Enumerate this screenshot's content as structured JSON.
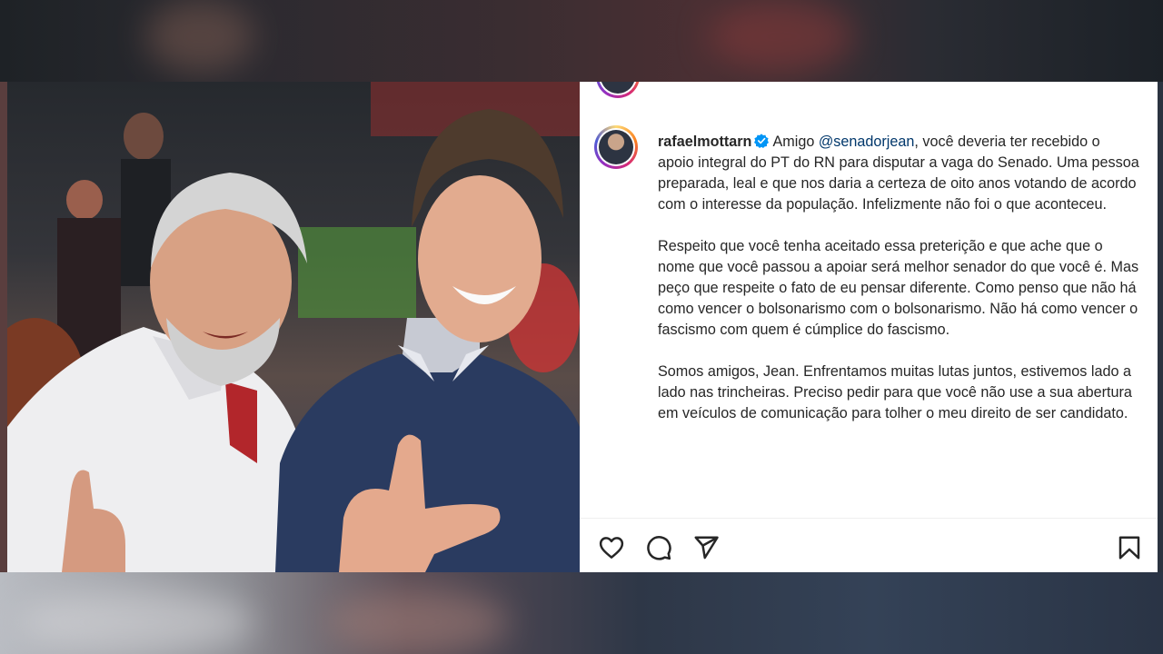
{
  "post": {
    "username": "rafaelmottarn",
    "caption_lead": "Amigo ",
    "mention": "@senadorjean",
    "paragraph1_rest": ", você deveria ter recebido o apoio integral do PT do RN para disputar a vaga do Senado. Uma pessoa preparada, leal e que nos daria a certeza de oito anos votando de acordo com o interesse da população. Infelizmente não foi o que aconteceu.",
    "paragraph2": "Respeito que você tenha aceitado essa preterição e que ache que o nome que você passou a apoiar será melhor senador do que você é. Mas peço que respeite o fato de eu pensar diferente. Como penso que não há como vencer o bolsonarismo com o bolsonarismo. Não há como vencer o fascismo com quem é cúmplice do fascismo.",
    "paragraph3": "Somos amigos, Jean. Enfrentamos muitas lutas juntos, estivemos lado a lado nas trincheiras. Preciso pedir para que você não use a sua abertura em veículos de comunicação para tolher o meu direito de ser candidato."
  },
  "icons": {
    "like": "heart-icon",
    "comment": "comment-icon",
    "share": "send-icon",
    "save": "bookmark-icon",
    "verified": "verified-badge-icon"
  },
  "colors": {
    "text": "#262626",
    "mention": "#00376b",
    "verified": "#0095f6",
    "divider": "#efefef"
  }
}
